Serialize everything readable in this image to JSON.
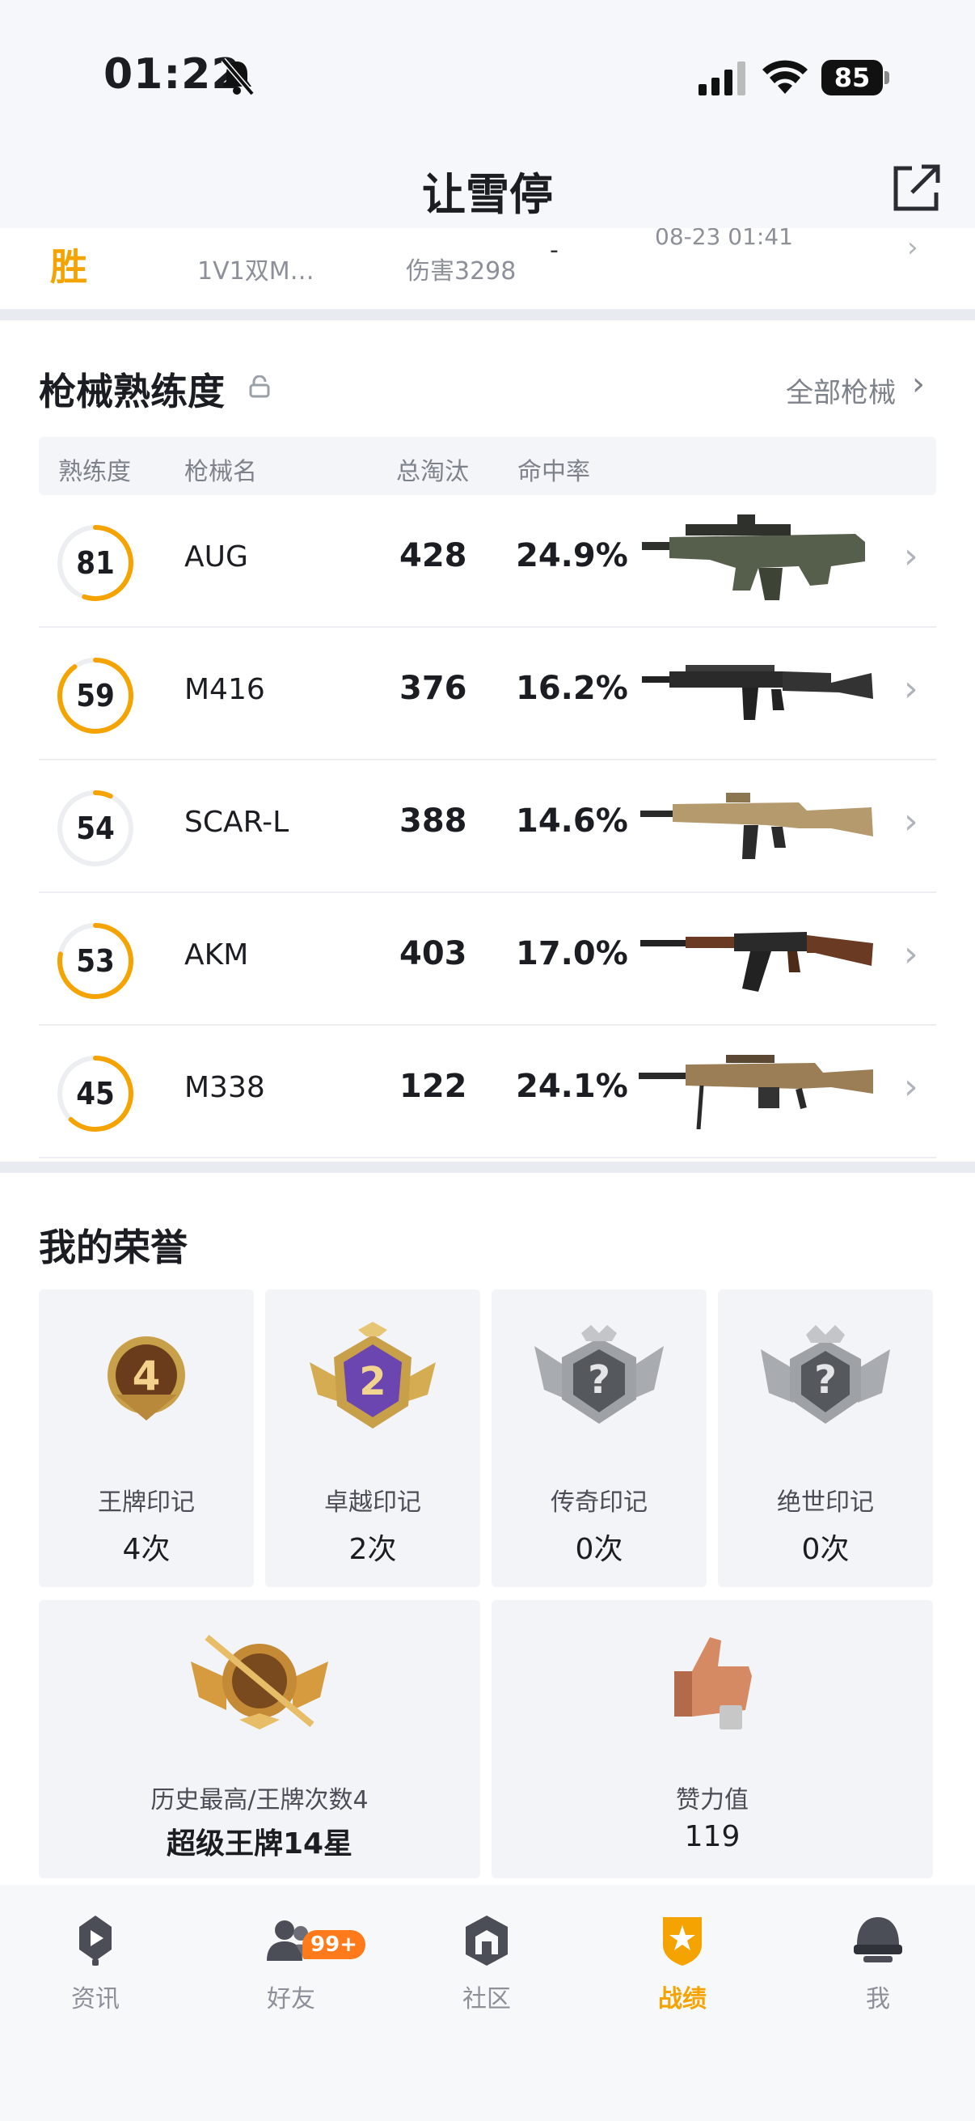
{
  "status_bar": {
    "time": "01:22",
    "battery": "85"
  },
  "header": {
    "title": "让雪停"
  },
  "match": {
    "result": "胜",
    "mode": "1V1双M…",
    "damage": "伤害3298",
    "dash": "-",
    "time": "08-23 01:41"
  },
  "weapons": {
    "title": "枪械熟练度",
    "all_link": "全部枪械",
    "columns": {
      "proficiency": "熟练度",
      "name": "枪械名",
      "kills": "总淘汰",
      "accuracy": "命中率"
    },
    "rows": [
      {
        "proficiency": "81",
        "progress": 0.55,
        "name": "AUG",
        "kills": "428",
        "accuracy": "24.9%",
        "gun_icon": "aug-rifle-icon"
      },
      {
        "proficiency": "59",
        "progress": 0.9,
        "name": "M416",
        "kills": "376",
        "accuracy": "16.2%",
        "gun_icon": "m416-rifle-icon"
      },
      {
        "proficiency": "54",
        "progress": 0.07,
        "name": "SCAR-L",
        "kills": "388",
        "accuracy": "14.6%",
        "gun_icon": "scarl-rifle-icon"
      },
      {
        "proficiency": "53",
        "progress": 0.78,
        "name": "AKM",
        "kills": "403",
        "accuracy": "17.0%",
        "gun_icon": "akm-rifle-icon"
      },
      {
        "proficiency": "45",
        "progress": 0.62,
        "name": "M338",
        "kills": "122",
        "accuracy": "24.1%",
        "gun_icon": "m338-lmg-icon"
      }
    ]
  },
  "honor": {
    "title": "我的荣誉",
    "marks": [
      {
        "label": "王牌印记",
        "count": "4次",
        "icon_text": "4"
      },
      {
        "label": "卓越印记",
        "count": "2次",
        "icon_text": "2"
      },
      {
        "label": "传奇印记",
        "count": "0次",
        "icon_text": "?"
      },
      {
        "label": "绝世印记",
        "count": "0次",
        "icon_text": "?"
      }
    ],
    "best": {
      "label": "历史最高/王牌次数4",
      "value": "超级王牌14星"
    },
    "likes": {
      "label": "赞力值",
      "value": "119"
    }
  },
  "nav": {
    "items": [
      {
        "label": "资讯"
      },
      {
        "label": "好友"
      },
      {
        "label": "社区"
      },
      {
        "label": "战绩"
      },
      {
        "label": "我"
      }
    ],
    "friends_badge": "99+",
    "active_color": "#f5a300"
  },
  "colors": {
    "accent": "#f5a300",
    "ring_track": "#eceef2"
  }
}
